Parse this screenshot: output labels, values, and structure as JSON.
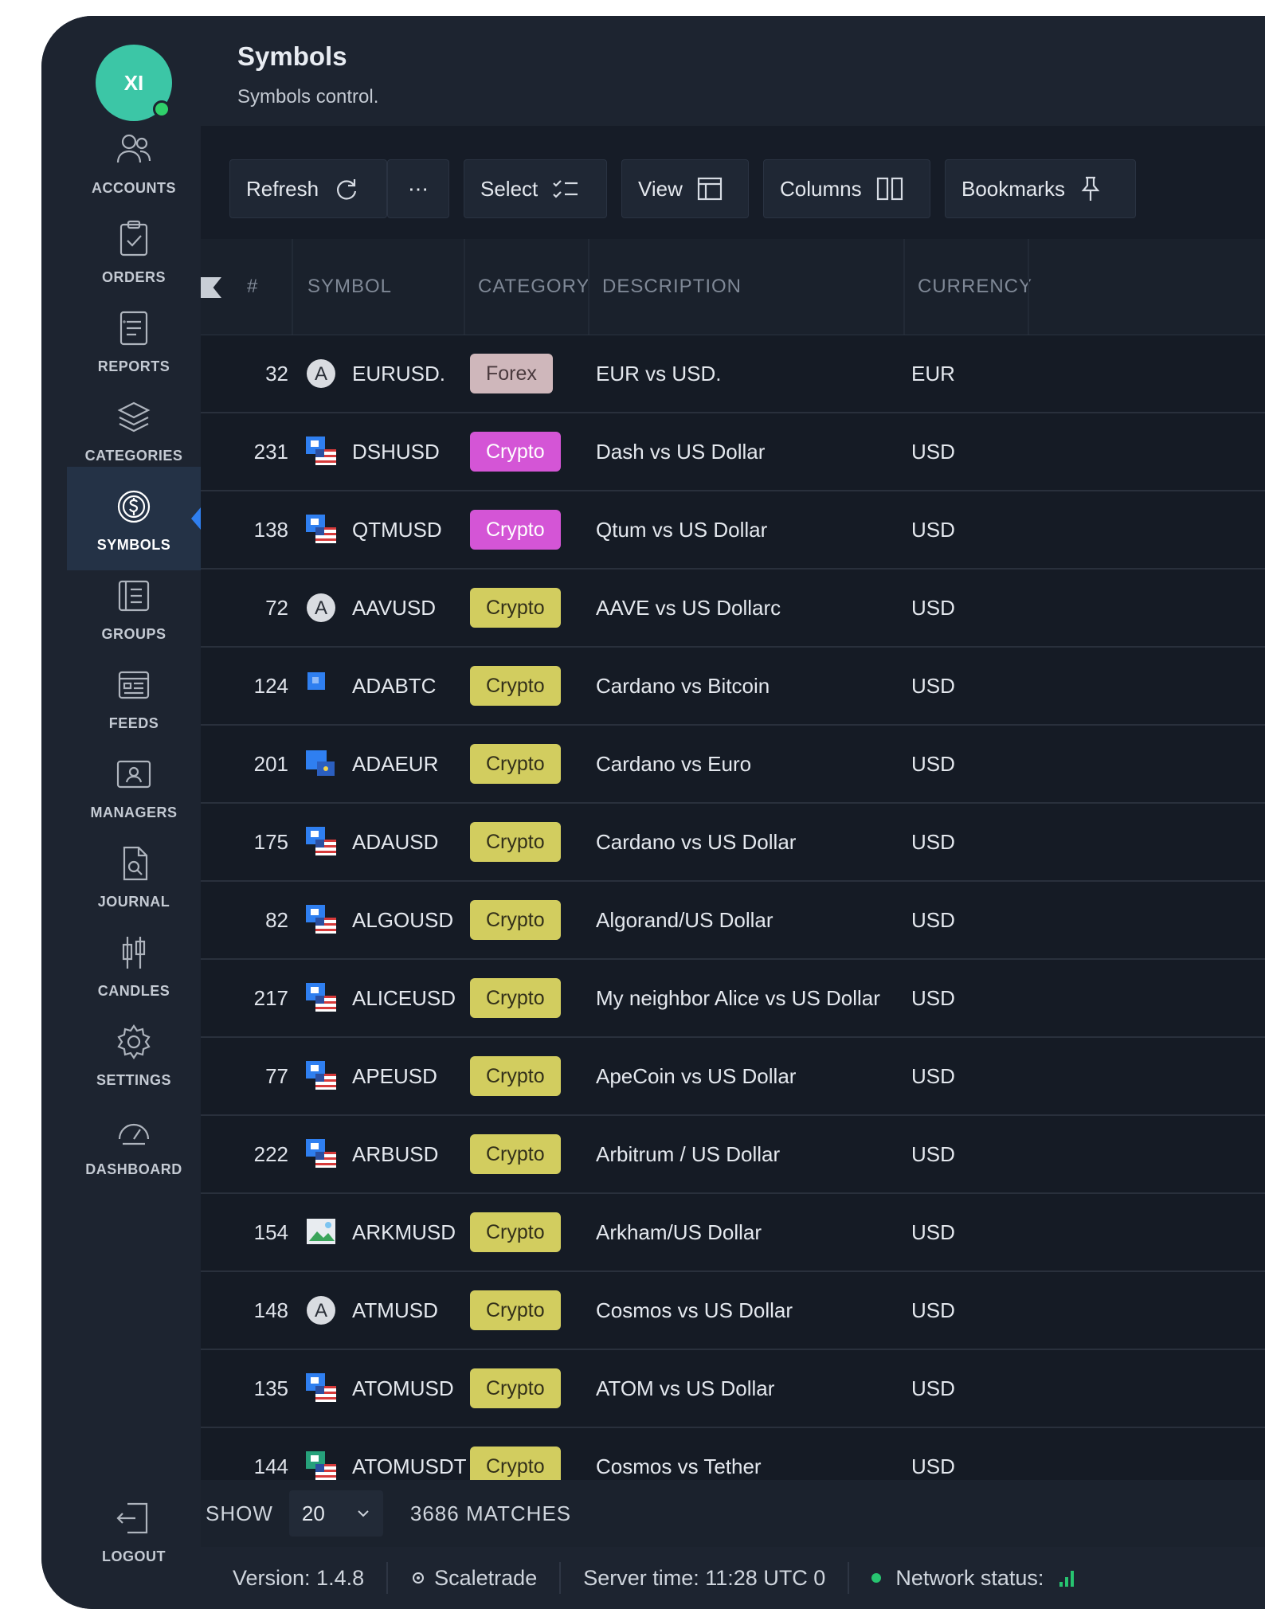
{
  "user": {
    "initials": "XI"
  },
  "sidebar": {
    "items": [
      {
        "label": "ACCOUNTS",
        "icon": "users-icon"
      },
      {
        "label": "ORDERS",
        "icon": "clipboard-check-icon"
      },
      {
        "label": "REPORTS",
        "icon": "document-list-icon"
      },
      {
        "label": "CATEGORIES",
        "icon": "layers-icon"
      },
      {
        "label": "SYMBOLS",
        "icon": "dollar-circle-icon",
        "active": true
      },
      {
        "label": "GROUPS",
        "icon": "list-box-icon"
      },
      {
        "label": "FEEDS",
        "icon": "feed-calendar-icon"
      },
      {
        "label": "MANAGERS",
        "icon": "id-card-icon"
      },
      {
        "label": "JOURNAL",
        "icon": "file-search-icon"
      },
      {
        "label": "CANDLES",
        "icon": "candlestick-icon"
      },
      {
        "label": "SETTINGS",
        "icon": "gear-icon"
      },
      {
        "label": "DASHBOARD",
        "icon": "speedometer-icon"
      }
    ],
    "logout": "LOGOUT"
  },
  "header": {
    "title": "Symbols",
    "subtitle": "Symbols control."
  },
  "toolbar": {
    "refresh": "Refresh",
    "more": "⋯",
    "select": "Select",
    "view": "View",
    "columns": "Columns",
    "bookmarks": "Bookmarks"
  },
  "table": {
    "headers": {
      "num": "#",
      "symbol": "SYMBOL",
      "category": "CATEGORY",
      "description": "DESCRIPTION",
      "currency": "CURRENCY"
    },
    "rows": [
      {
        "num": "32",
        "symbol": "EURUSD.",
        "category": "Forex",
        "badge": "forex",
        "icon": "a",
        "description": "EUR vs USD.",
        "currency": "EUR"
      },
      {
        "num": "231",
        "symbol": "DSHUSD",
        "category": "Crypto",
        "badge": "crypto-pink",
        "icon": "flag",
        "description": "Dash vs US Dollar",
        "currency": "USD"
      },
      {
        "num": "138",
        "symbol": "QTMUSD",
        "category": "Crypto",
        "badge": "crypto-pink",
        "icon": "flag",
        "description": "Qtum vs US Dollar",
        "currency": "USD"
      },
      {
        "num": "72",
        "symbol": "AAVUSD",
        "category": "Crypto",
        "badge": "crypto-yellow",
        "icon": "a",
        "description": "AAVE vs US Dollarc",
        "currency": "USD"
      },
      {
        "num": "124",
        "symbol": "ADABTC",
        "category": "Crypto",
        "badge": "crypto-yellow",
        "icon": "square",
        "description": "Cardano vs Bitcoin",
        "currency": "USD"
      },
      {
        "num": "201",
        "symbol": "ADAEUR",
        "category": "Crypto",
        "badge": "crypto-yellow",
        "icon": "square2",
        "description": "Cardano vs Euro",
        "currency": "USD"
      },
      {
        "num": "175",
        "symbol": "ADAUSD",
        "category": "Crypto",
        "badge": "crypto-yellow",
        "icon": "flag",
        "description": "Cardano vs US Dollar",
        "currency": "USD"
      },
      {
        "num": "82",
        "symbol": "ALGOUSD",
        "category": "Crypto",
        "badge": "crypto-yellow",
        "icon": "flag",
        "description": "Algorand/US Dollar",
        "currency": "USD"
      },
      {
        "num": "217",
        "symbol": "ALICEUSD",
        "category": "Crypto",
        "badge": "crypto-yellow",
        "icon": "flag",
        "description": "My neighbor Alice vs US Dollar",
        "currency": "USD"
      },
      {
        "num": "77",
        "symbol": "APEUSD",
        "category": "Crypto",
        "badge": "crypto-yellow",
        "icon": "flag",
        "description": "ApeCoin vs US Dollar",
        "currency": "USD"
      },
      {
        "num": "222",
        "symbol": "ARBUSD",
        "category": "Crypto",
        "badge": "crypto-yellow",
        "icon": "flag",
        "description": "Arbitrum / US Dollar",
        "currency": "USD"
      },
      {
        "num": "154",
        "symbol": "ARKMUSD",
        "category": "Crypto",
        "badge": "crypto-yellow",
        "icon": "image",
        "description": "Arkham/US Dollar",
        "currency": "USD"
      },
      {
        "num": "148",
        "symbol": "ATMUSD",
        "category": "Crypto",
        "badge": "crypto-yellow",
        "icon": "a",
        "description": "Cosmos vs US Dollar",
        "currency": "USD"
      },
      {
        "num": "135",
        "symbol": "ATOMUSD",
        "category": "Crypto",
        "badge": "crypto-yellow",
        "icon": "flag",
        "description": "ATOM vs US Dollar",
        "currency": "USD"
      },
      {
        "num": "144",
        "symbol": "ATOMUSDT",
        "category": "Crypto",
        "badge": "crypto-yellow",
        "icon": "flag-teal",
        "description": "Cosmos vs Tether",
        "currency": "USD"
      }
    ]
  },
  "pager": {
    "show_label": "SHOW",
    "page_size": "20",
    "matches": "3686 MATCHES"
  },
  "status": {
    "version": "Version: 1.4.8",
    "brand": "Scaletrade",
    "server_time": "Server time:  11:28  UTC 0",
    "network": "Network status:"
  },
  "colors": {
    "accent": "#2f7ff0",
    "avatar": "#3cc6a6",
    "forex_badge": "#cfb7bb",
    "crypto_pink": "#d455d6",
    "crypto_yellow": "#d2cd5f",
    "online": "#27c470"
  }
}
